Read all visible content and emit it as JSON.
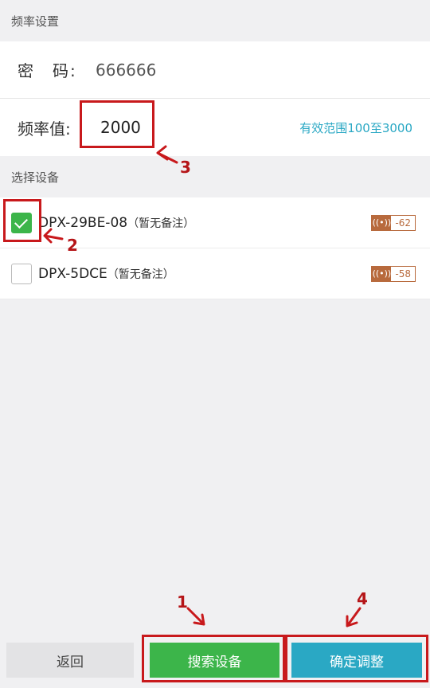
{
  "frequency_section": {
    "title": "频率设置",
    "password_label": "密　码:",
    "password_value": "666666",
    "frequency_label": "频率值:",
    "frequency_value": "2000",
    "frequency_hint": "有效范围100至3000"
  },
  "device_section": {
    "title": "选择设备",
    "devices": [
      {
        "name": "DPX-29BE-08",
        "note": "（暂无备注）",
        "checked": true,
        "signal": "-62"
      },
      {
        "name": "DPX-5DCE",
        "note": "（暂无备注）",
        "checked": false,
        "signal": "-58"
      }
    ]
  },
  "buttons": {
    "back": "返回",
    "search": "搜索设备",
    "confirm": "确定调整"
  },
  "annotations": [
    "1",
    "2",
    "3",
    "4"
  ],
  "colors": {
    "accent_green": "#3cb54a",
    "accent_teal": "#2aa8c4",
    "signal_brown": "#b86a3d",
    "annotation_red": "#c8191c"
  },
  "icons": {
    "signal": "signal-icon",
    "check": "check-icon"
  }
}
